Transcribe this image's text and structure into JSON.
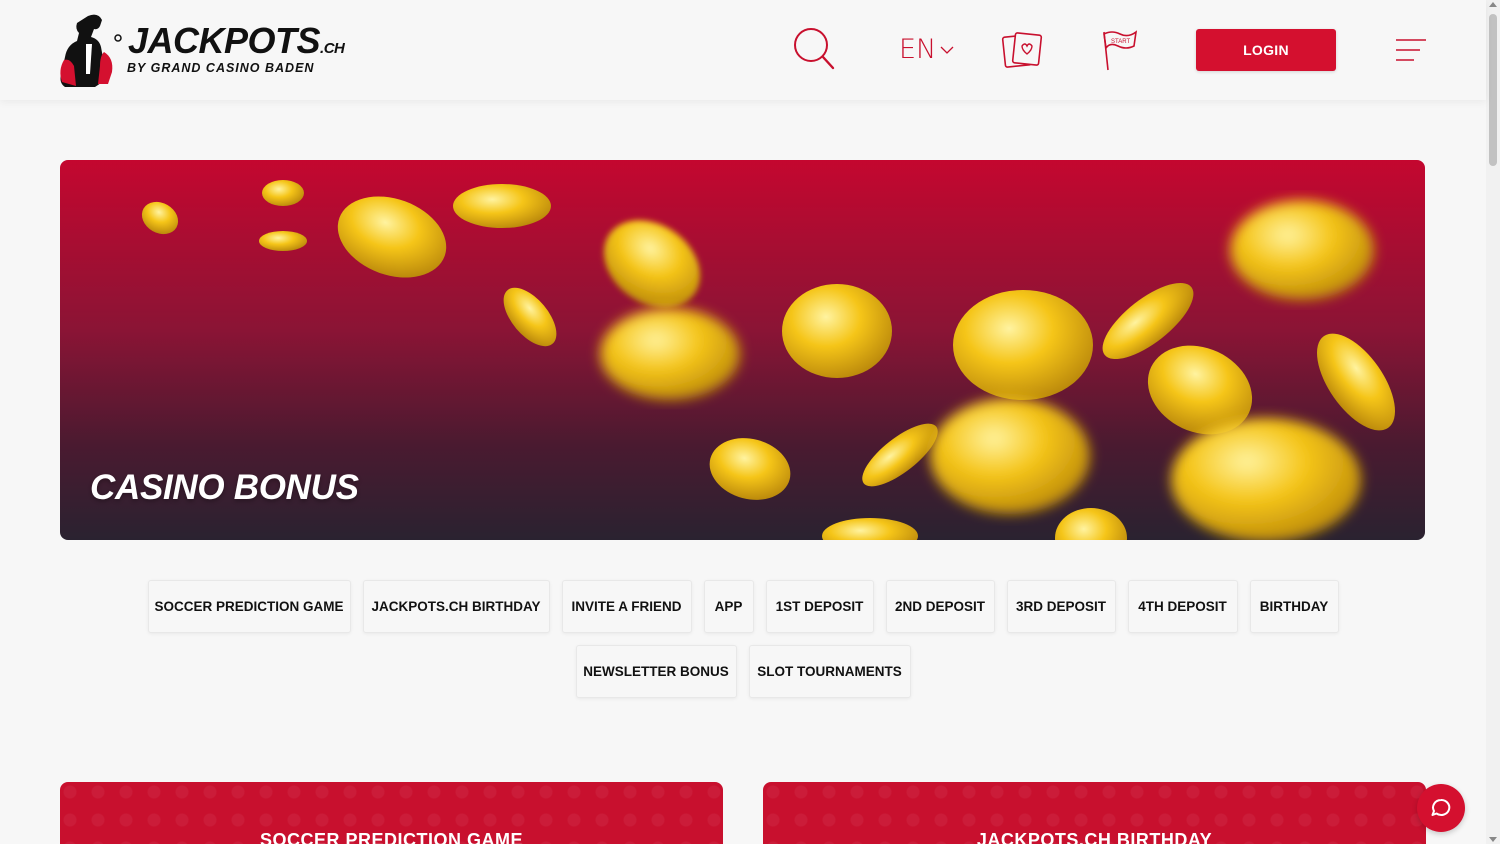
{
  "header": {
    "logo_main": "JACKPOTS",
    "logo_tld": ".CH",
    "logo_sub": "BY GRAND CASINO BADEN",
    "language": "EN",
    "login_label": "LOGIN"
  },
  "hero": {
    "title": "CASINO BONUS"
  },
  "tabs_row1": [
    "SOCCER PREDICTION GAME",
    "JACKPOTS.CH BIRTHDAY",
    "INVITE A FRIEND",
    "APP",
    "1ST DEPOSIT",
    "2ND DEPOSIT",
    "3RD DEPOSIT",
    "4TH DEPOSIT",
    "BIRTHDAY"
  ],
  "tabs_row2": [
    "NEWSLETTER BONUS",
    "SLOT TOURNAMENTS"
  ],
  "cards": [
    {
      "title": "SOCCER PREDICTION GAME"
    },
    {
      "title": "JACKPOTS.CH BIRTHDAY"
    }
  ],
  "colors": {
    "brand_red": "#d4102f",
    "page_bg": "#f7f7f7"
  }
}
